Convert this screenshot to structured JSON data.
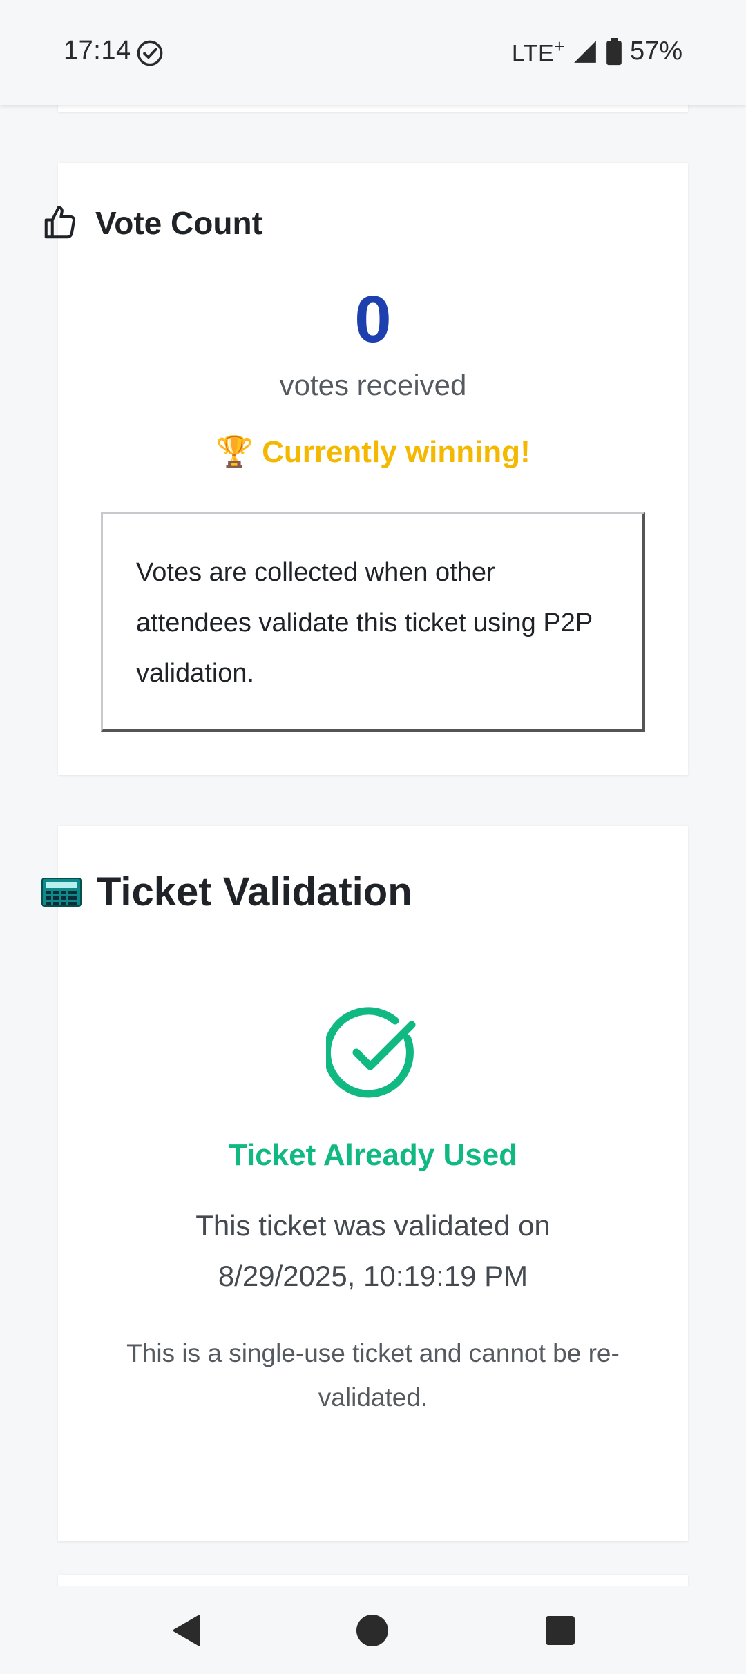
{
  "status_bar": {
    "time": "17:14",
    "network": "LTE",
    "network_plus": "+",
    "battery": "57%"
  },
  "vote_card": {
    "title": "Vote Count",
    "count": "0",
    "subtitle": "votes received",
    "winning_emoji": "🏆",
    "winning_text": "Currently winning!",
    "info_text": "Votes are collected when other attendees validate this ticket using P2P validation."
  },
  "ticket_card": {
    "title": "Ticket Validation",
    "status_title": "Ticket Already Used",
    "status_desc_line1": "This ticket was validated on",
    "status_desc_line2": "8/29/2025, 10:19:19 PM",
    "note": "This is a single-use ticket and cannot be re-validated."
  },
  "colors": {
    "accent_blue": "#1e40af",
    "winning_yellow": "#f5b800",
    "success_green": "#10b981"
  },
  "icons": {
    "status_check": "check-circle-icon",
    "signal": "signal-icon",
    "battery": "battery-icon",
    "vote": "thumbs-up-icon",
    "ticket": "calculator-icon",
    "validated": "check-circle-icon",
    "nav_back": "back-triangle-icon",
    "nav_home": "home-circle-icon",
    "nav_recent": "recent-square-icon"
  }
}
